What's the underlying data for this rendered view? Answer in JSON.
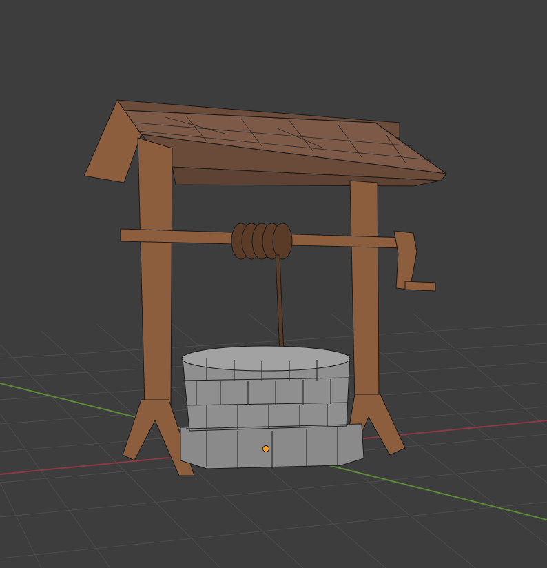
{
  "viewport": {
    "mode": "3d-viewport",
    "shading": "solid-wireframe-overlay",
    "background_color": "#3d3d3d",
    "grid_color": "#4a4a4a",
    "x_axis_color": "#8a3a44",
    "y_axis_color": "#5d8a35"
  },
  "scene": {
    "object": "wishing-well",
    "wood_color": "#8c5e3e",
    "wood_dark_color": "#6e4a31",
    "roof_color": "#7d5a47",
    "stone_color": "#8c8c8c",
    "stone_light_color": "#a2a2a2",
    "rope_color": "#5a3b27",
    "edge_color": "#1b1b1b",
    "origin_color": "#ff9c1a"
  }
}
